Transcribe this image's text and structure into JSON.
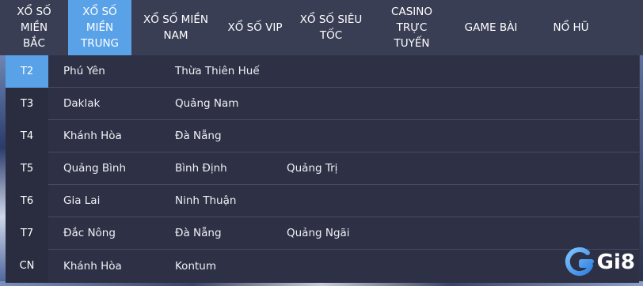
{
  "nav": {
    "items": [
      {
        "lines": [
          "XỔ SỐ MIỀN",
          "BẮC"
        ]
      },
      {
        "lines": [
          "XỔ SỐ",
          "MIỀN",
          "TRUNG"
        ],
        "active": true
      },
      {
        "lines": [
          "XỔ SỐ MIỀN",
          "NAM"
        ]
      },
      {
        "lines": [
          "XỔ SỐ VIP"
        ]
      },
      {
        "lines": [
          "XỔ SỐ SIÊU",
          "TỐC"
        ]
      },
      {
        "lines": [
          "CASINO",
          "TRỰC",
          "TUYẾN"
        ]
      },
      {
        "lines": [
          "GAME BÀI"
        ]
      },
      {
        "lines": [
          "NỔ HŨ"
        ]
      }
    ]
  },
  "schedule": [
    {
      "day": "T2",
      "active": true,
      "provinces": [
        "Phú Yên",
        "Thừa Thiên Huế"
      ]
    },
    {
      "day": "T3",
      "provinces": [
        "Daklak",
        "Quảng Nam"
      ]
    },
    {
      "day": "T4",
      "provinces": [
        "Khánh Hòa",
        "Đà Nẵng"
      ]
    },
    {
      "day": "T5",
      "provinces": [
        "Quảng Bình",
        "Bình Định",
        "Quảng Trị"
      ]
    },
    {
      "day": "T6",
      "provinces": [
        "Gia Lai",
        "Ninh Thuận"
      ]
    },
    {
      "day": "T7",
      "provinces": [
        "Đắc Nông",
        "Đà Nẵng",
        "Quảng Ngãi"
      ]
    },
    {
      "day": "CN",
      "provinces": [
        "Khánh Hòa",
        "Kontum"
      ]
    }
  ],
  "logo": {
    "text": "Gi8",
    "icon": "g-logo-icon"
  },
  "colors": {
    "accent": "#5aa2e8",
    "panel": "#2e3146",
    "nav": "#3a3e55"
  }
}
